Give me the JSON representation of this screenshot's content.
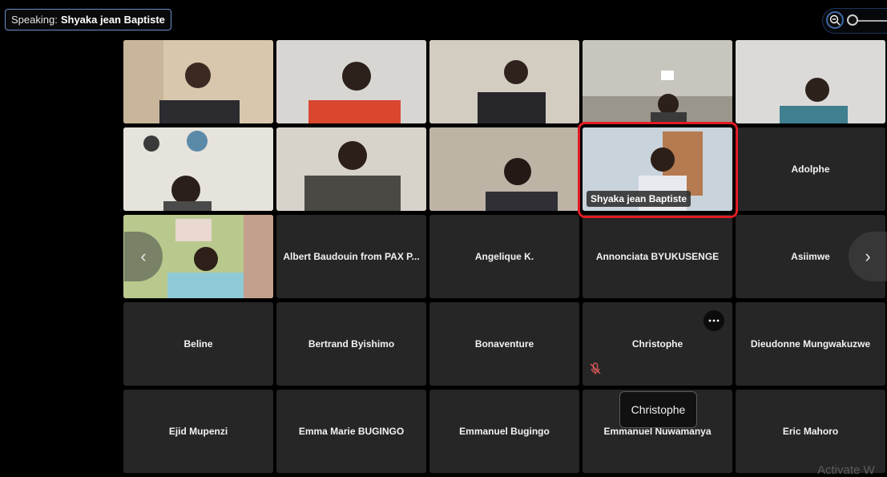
{
  "header": {
    "speaking_label": "Speaking:",
    "speaking_name": "Shyaka jean Baptiste"
  },
  "zoom": {
    "icon": "zoom-out-icon"
  },
  "active_speaker": {
    "label": "Shyaka jean Baptiste"
  },
  "tiles": [
    "Adolphe",
    "Albert Baudouin from PAX P...",
    "Angelique K.",
    "Annonciata BYUKUSENGE",
    "Asiimwe",
    "Beline",
    "Bertrand Byishimo",
    "Bonaventure",
    "Christophe",
    "Dieudonne Mungwakuzwe",
    "Ejid Mupenzi",
    "Emma Marie BUGINGO",
    "Emmanuel Bugingo",
    "Emmanuel Nuwamanya",
    "Eric Mahoro"
  ],
  "tooltip": "Christophe",
  "watermark": "Activate W",
  "colors": {
    "speaker_highlight": "#4d9bea",
    "annotation_box": "#e21c24",
    "tile_bg": "#262626"
  }
}
